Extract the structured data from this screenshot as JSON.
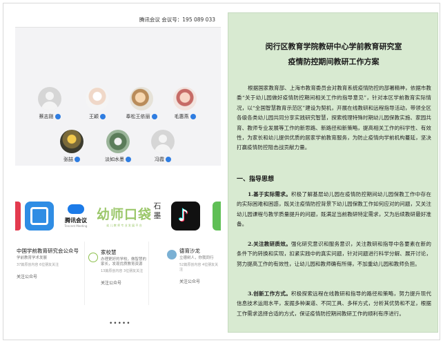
{
  "meeting": {
    "id_text": "腾讯会议 会议号：195 089 033",
    "participants": [
      {
        "name": "蔡志刚",
        "avatar": "default-avatar"
      },
      {
        "name": "王颖",
        "avatar": "photo-avatar"
      },
      {
        "name": "奉松王依丽",
        "avatar": "photo-avatar"
      },
      {
        "name": "毛惠燕",
        "avatar": "photo-avatar"
      },
      {
        "name": "张喆",
        "avatar": "photo-avatar"
      },
      {
        "name": "淡如水墨",
        "avatar": "photo-avatar"
      },
      {
        "name": "冯霞",
        "avatar": "default-avatar"
      }
    ]
  },
  "apps": {
    "tiles": {
      "tencent_title": "腾讯会议",
      "tencent_sub": "Tencent Meeting",
      "kids_title": "幼师口袋",
      "kids_sub": "幼 儿 教 师 专 业 发 展 平 台",
      "stone": "石 墨"
    },
    "accounts": [
      {
        "name": "中国学前教育研究会公众号",
        "desc": "学前教育学术发展",
        "meta": "37篇原创内容 6位朋友关注",
        "follow": "关注公众号"
      },
      {
        "name": "家校慧",
        "desc": "办理更好的学校，做智慧的家长，发现优质教育资源",
        "meta": "13篇原创内容 3位朋友关注",
        "follow": "关注公众号"
      },
      {
        "name": "德育沙龙",
        "desc": "立德树人，你我同行",
        "meta": "52篇原创内容 4位朋友关注",
        "follow": "关注公众号"
      }
    ],
    "pager": "•••••"
  },
  "doc": {
    "title_line1": "闵行区教育学院教研中心学前教育研究室",
    "title_line2": "疫情防控期间教研工作方案",
    "intro": "根据国家教育部、上海市教育委员会对教育系统疫情防控的部署精神，依据市教委“关于幼儿园做好疫情防控期间相关工作的指导意见”，针对本区学前教育实际情况，以“全国智慧教育示范区”建设为契机，开展在线教研和远程指导活动，带领全区各级各类幼儿园共同分享实践研究智慧，探索梳理特殊时期幼儿园保教实施、家园共育、教师专业发展等工作的新思路、新路径和新策略，提高相关工作的科学性、有效性，为家长和幼儿提供优质的居家学前教育服务，为防止疫情向学前机构蔓延，坚决打赢疫情防控阻击战贡献力量。",
    "section1": "一、指导思想",
    "p1_lead": "1.基于实际需求。",
    "p1_body": "积极了解基层幼儿园在疫情防控期间幼儿园保教工作中存在的实际困难和困惑，既关注疫情防控背景下幼儿园保教工作如何应对的问题，又关注幼儿园课程与教学质量提升的问题，既满足当前教研特定需求，又为后续教研最好准备。",
    "p2_lead": "2.关注教研质效。",
    "p2_body": "强化研究意识和服务意识，关注教研和指导中各要素在新的条件下的转换和实现，扣紧实践中的真实问题，针对问题进行科学分解、展开讨论，努力提高工作的有效性，让幼儿园和教师确有所得，不加重幼儿园和教师负担。",
    "p3_lead": "3.创新工作方式。",
    "p3_body": "积极探索远程在线教研和指导的路径和策略，努力提升现代信息技术运用水平，发掘多种渠道、不同工具、多样方式，分析其优势和不足，根据工作需求选择合适的方式，保证疫情防控期间教研工作的顺利有序进行。"
  },
  "colors": {
    "doc_background": "#d8ead1",
    "mic_blue": "#2f7de1",
    "meeting_background": "#f3f3f5"
  }
}
